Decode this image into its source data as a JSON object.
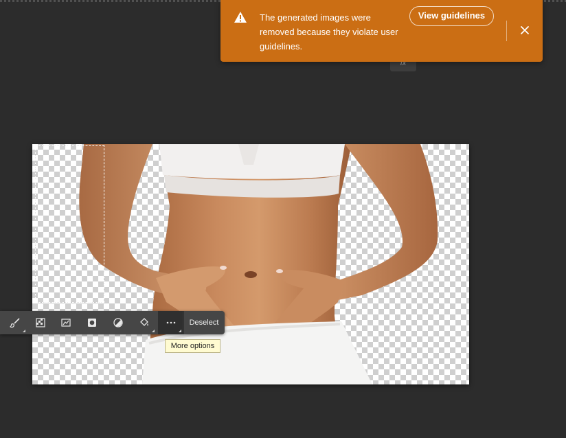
{
  "toast": {
    "message": "The generated images were removed because they violate user guidelines.",
    "button_label": "View guidelines",
    "warning_icon": "warning-triangle-icon",
    "close_icon": "close-icon",
    "color": "#cb6e14"
  },
  "taskbar": {
    "tools": [
      {
        "name": "brush-icon"
      },
      {
        "name": "select-subject-icon"
      },
      {
        "name": "transform-selection-icon"
      },
      {
        "name": "mask-icon"
      },
      {
        "name": "invert-selection-icon"
      },
      {
        "name": "fill-icon"
      },
      {
        "name": "more-options-icon"
      }
    ],
    "deselect_label": "Deselect",
    "tooltip": "More options"
  },
  "fx_label": "fx"
}
